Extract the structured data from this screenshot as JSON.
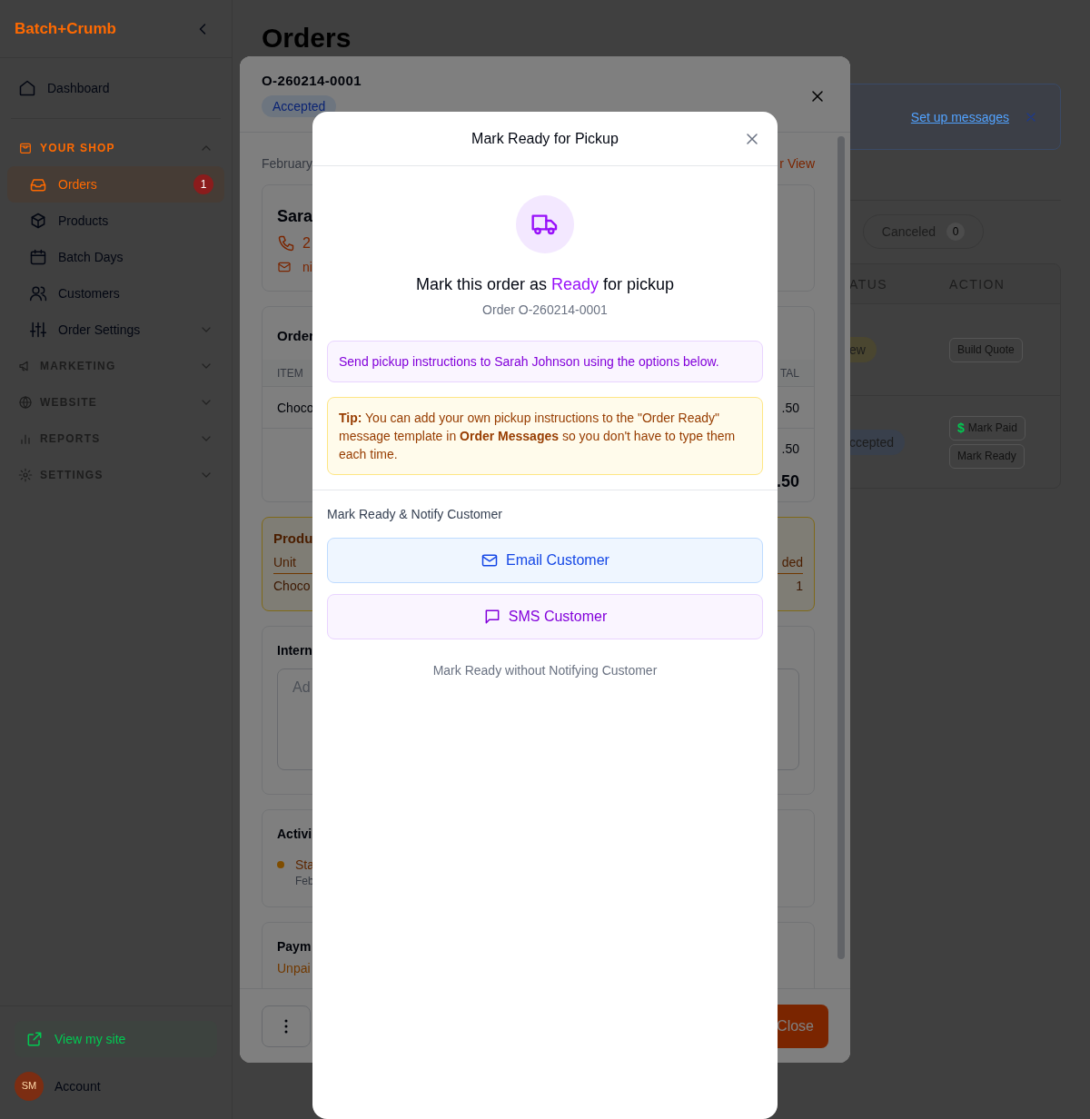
{
  "sidebar": {
    "brand": "Batch+Crumb",
    "top_items": [
      {
        "label": "Dashboard",
        "selected": false
      }
    ],
    "sections": [
      {
        "label": "YOUR SHOP",
        "expanded": true,
        "items": [
          {
            "label": "Orders",
            "selected": true,
            "badge": "1"
          },
          {
            "label": "Products",
            "selected": false
          },
          {
            "label": "Batch Days",
            "selected": false
          },
          {
            "label": "Customers",
            "selected": false
          },
          {
            "label": "Order Settings",
            "selected": false,
            "expanded": false
          }
        ]
      },
      {
        "label": "MARKETING",
        "expanded": false
      },
      {
        "label": "WEBSITE",
        "expanded": false
      },
      {
        "label": "REPORTS",
        "expanded": false
      },
      {
        "label": "SETTINGS",
        "expanded": false
      }
    ],
    "view_site": "View my site",
    "account": {
      "initials": "SM",
      "label": "Account"
    }
  },
  "page": {
    "title": "Orders",
    "banner_link": "Set up messages",
    "filter_tabs": [
      {
        "label": "Canceled",
        "count": "0",
        "selected": false
      }
    ],
    "table": {
      "columns": [
        "ATUS",
        "ACTION"
      ],
      "rows": [
        {
          "status": "ew",
          "color": "#4a4630",
          "actions": [
            {
              "label": "Build Quote"
            }
          ]
        },
        {
          "status": "ccepted",
          "color": "#39404c",
          "actions": [
            {
              "icon_char": "$",
              "label": "Mark Paid"
            },
            {
              "label": "Mark Ready"
            }
          ]
        }
      ]
    }
  },
  "order_panel": {
    "order_number": "O-260214-0001",
    "status": "Accepted",
    "date": "February",
    "view_link": "r View",
    "customer": {
      "name": "Sara",
      "phone": "2",
      "email": "ni"
    },
    "items_card": {
      "title": "Order",
      "columns": [
        "ITEM",
        "TAL"
      ],
      "rows": [
        {
          "item": "Choco",
          "total": ".50"
        }
      ],
      "subtotal": ".50",
      "total": ".50"
    },
    "production_card": {
      "title": "Produ",
      "columns": [
        "Unit",
        "ded"
      ],
      "rows": [
        {
          "unit": "Choco",
          "needed": "1"
        }
      ]
    },
    "notes_card": {
      "title": "Intern",
      "placeholder": "Ad"
    },
    "activity_card": {
      "title": "Activi",
      "entries": [
        {
          "title": "Sta",
          "time": "Feb"
        }
      ]
    },
    "payment_card": {
      "title": "Paym",
      "status": "Unpai"
    },
    "close_button": "Close"
  },
  "modal": {
    "title": "Mark Ready for Pickup",
    "heading_before": "Mark this order as ",
    "heading_highlight": "Ready",
    "heading_after": " for pickup",
    "subtitle": "Order O-260214-0001",
    "info": "Send pickup instructions to Sarah Johnson using the options below.",
    "tip": "**Tip:** You can add your own pickup instructions to the \"Order Ready\" message template in **Order Messages** so you don't have to type them each time.",
    "notify_label": "Mark Ready & Notify Customer",
    "buttons": [
      {
        "kind": "email",
        "label": "Email Customer"
      },
      {
        "kind": "sms",
        "label": "SMS Customer"
      }
    ],
    "skip_link": "Mark Ready without Notifying Customer"
  }
}
